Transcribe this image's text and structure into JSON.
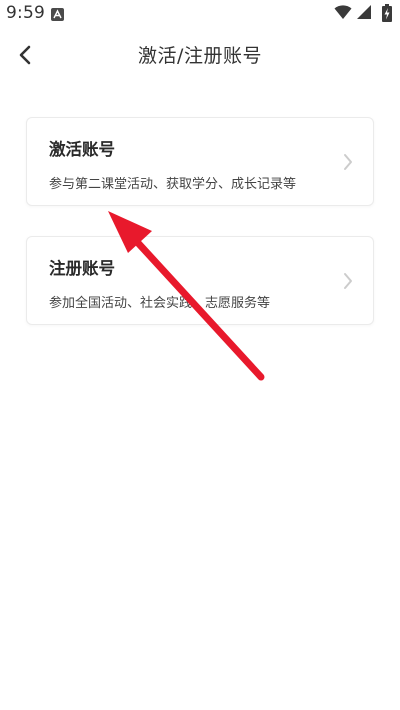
{
  "status_bar": {
    "time": "9:59",
    "notification_icon": "a-notification-icon",
    "wifi_icon": "wifi-icon",
    "signal_icon": "cellular-signal-icon",
    "battery_icon": "battery-charging-icon"
  },
  "header": {
    "back_icon": "chevron-left-icon",
    "title": "激活/注册账号"
  },
  "cards": [
    {
      "title": "激活账号",
      "description": "参与第二课堂活动、获取学分、成长记录等",
      "chevron_icon": "chevron-right-icon"
    },
    {
      "title": "注册账号",
      "description": "参加全国活动、社会实践、志愿服务等",
      "chevron_icon": "chevron-right-icon"
    }
  ],
  "annotation": {
    "arrow_color": "#e8192c"
  }
}
